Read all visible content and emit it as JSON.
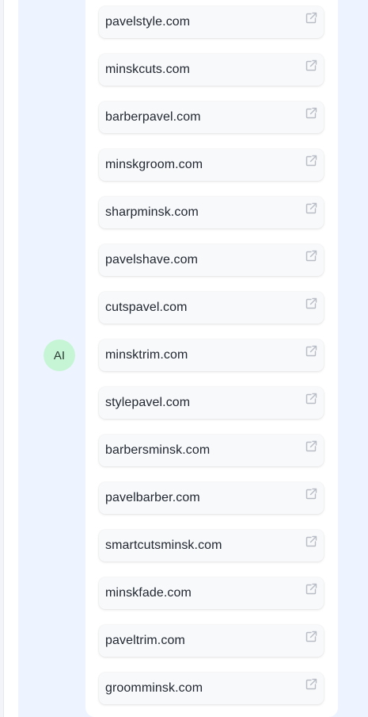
{
  "assistant": {
    "avatar_label": "AI"
  },
  "domains": [
    {
      "label": "pavelstyle.com"
    },
    {
      "label": "minskcuts.com"
    },
    {
      "label": "barberpavel.com"
    },
    {
      "label": "minskgroom.com"
    },
    {
      "label": "sharpminsk.com"
    },
    {
      "label": "pavelshave.com"
    },
    {
      "label": "cutspavel.com"
    },
    {
      "label": "minsktrim.com"
    },
    {
      "label": "stylepavel.com"
    },
    {
      "label": "barbersminsk.com"
    },
    {
      "label": "pavelbarber.com"
    },
    {
      "label": "smartcutsminsk.com"
    },
    {
      "label": "minskfade.com"
    },
    {
      "label": "paveltrim.com"
    },
    {
      "label": "groomminsk.com"
    }
  ],
  "icons": {
    "external_link": "external-link-icon"
  },
  "colors": {
    "chat_background": "#eef4ff",
    "avatar_background": "#c6f5d6",
    "card_background": "#f8f9fb",
    "icon_color": "#b8bcc4"
  }
}
